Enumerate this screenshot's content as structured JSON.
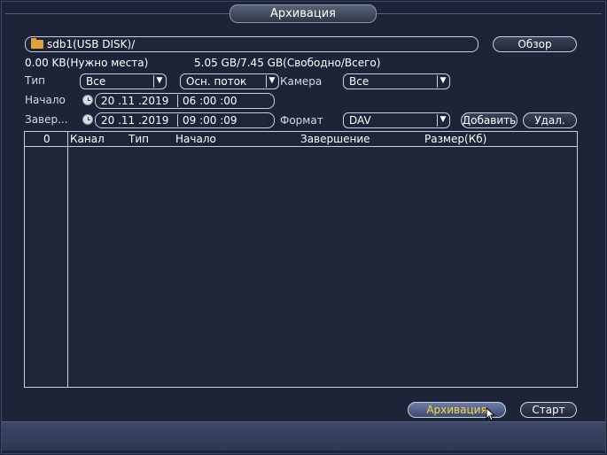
{
  "window": {
    "title": "Архивация"
  },
  "path": {
    "value": "sdb1(USB DISK)/",
    "browse_label": "Обзор"
  },
  "space": {
    "required_text": "0.00 KB(Нужно места)",
    "free_total_text": "5.05 GB/7.45 GB(Свободно/Всего)"
  },
  "filters": {
    "type_label": "Тип",
    "type_value": "Все",
    "stream_value": "Осн. поток",
    "camera_label": "Камера",
    "camera_value": "Все",
    "start_label": "Начало",
    "start_date": "20 .11 .2019",
    "start_time": "06 :00 :00",
    "end_label": "Завер...",
    "end_date": "20 .11 .2019",
    "end_time": "09 :00 :09",
    "format_label": "Формат",
    "format_value": "DAV",
    "add_label": "Добавить",
    "delete_label": "Удал."
  },
  "table": {
    "headers": [
      "0",
      "Канал",
      "Тип",
      "Начало",
      "Завершение",
      "Размер(Кб)"
    ],
    "rows": []
  },
  "actions": {
    "backup_label": "Архивация",
    "start_label": "Старт"
  },
  "colors": {
    "background": "#1d2438",
    "highlight_text": "#ffd23a",
    "border": "#c9d0e0"
  },
  "icons": {
    "folder": "folder-icon",
    "clock": "clock-icon",
    "cursor": "mouse-pointer-icon"
  }
}
